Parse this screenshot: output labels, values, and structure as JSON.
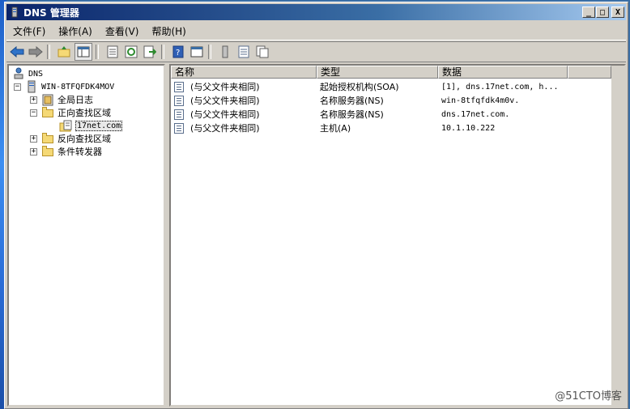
{
  "window": {
    "title": "DNS 管理器",
    "buttons": {
      "minimize": "_",
      "maximize": "□",
      "close": "X"
    }
  },
  "menu": [
    {
      "label": "文件(F)"
    },
    {
      "label": "操作(A)"
    },
    {
      "label": "查看(V)"
    },
    {
      "label": "帮助(H)"
    }
  ],
  "toolbar": {
    "icons": [
      "back-arrow-icon",
      "forward-arrow-icon",
      "up-folder-icon",
      "show-hide-tree-icon",
      "properties-icon",
      "refresh-icon",
      "export-list-icon",
      "help-icon",
      "view-icon",
      "new-record-icon",
      "new-record-list-icon",
      "copy-icon"
    ]
  },
  "tree": {
    "root": "DNS",
    "server": "WIN-8TFQFDK4MOV",
    "global_logs": "全局日志",
    "forward_zones": "正向查找区域",
    "zone": "17net.com",
    "reverse_zones": "反向查找区域",
    "conditional_forwarders": "条件转发器",
    "expander_minus": "−",
    "expander_plus": "+"
  },
  "list": {
    "columns": [
      "名称",
      "类型",
      "数据"
    ],
    "rows": [
      {
        "name": "(与父文件夹相同)",
        "type": "起始授权机构(SOA)",
        "data": "[1], dns.17net.com, h..."
      },
      {
        "name": "(与父文件夹相同)",
        "type": "名称服务器(NS)",
        "data": "win-8tfqfdk4m0v."
      },
      {
        "name": "(与父文件夹相同)",
        "type": "名称服务器(NS)",
        "data": "dns.17net.com."
      },
      {
        "name": "(与父文件夹相同)",
        "type": "主机(A)",
        "data": "10.1.10.222"
      }
    ]
  },
  "watermark": "@51CTO博客",
  "colors": {
    "titlebar_start": "#0a246a",
    "window_bg": "#d4d0c8",
    "folder": "#f5d976"
  }
}
